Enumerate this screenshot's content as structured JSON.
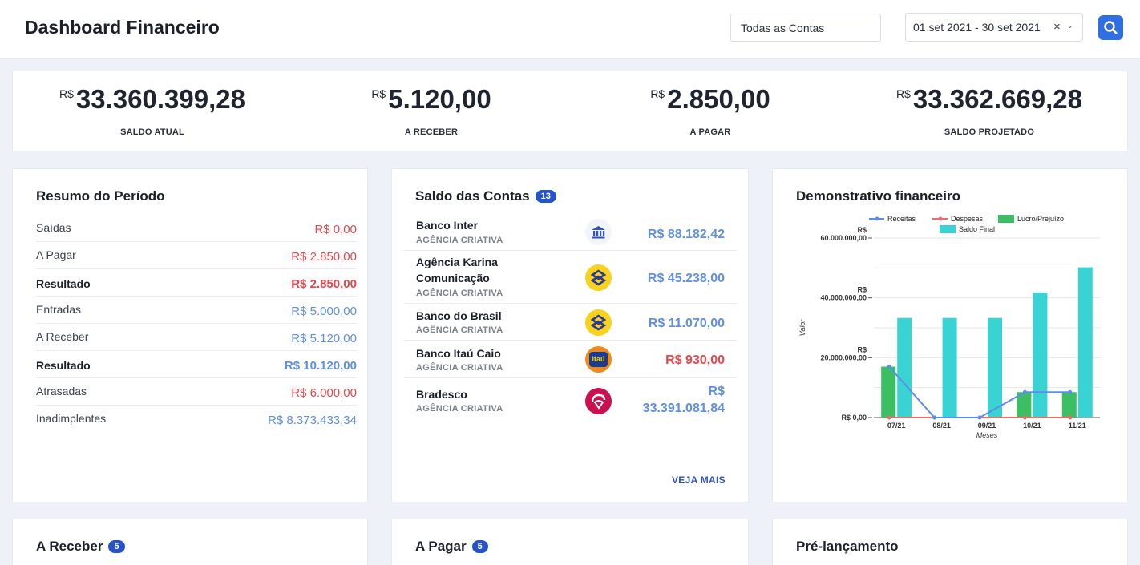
{
  "header": {
    "title": "Dashboard Financeiro",
    "account_filter": "Todas as Contas",
    "date_range": "01 set 2021 - 30 set 2021",
    "clear_symbol": "×",
    "chevron_symbol": "⌄"
  },
  "kpis": [
    {
      "currency": "R$",
      "value": "33.360.399,28",
      "label": "SALDO ATUAL",
      "color": "#5f8fe8"
    },
    {
      "currency": "R$",
      "value": "5.120,00",
      "label": "A RECEBER",
      "color": "#5f8fe8"
    },
    {
      "currency": "R$",
      "value": "2.850,00",
      "label": "A PAGAR",
      "color": "#e8464b"
    },
    {
      "currency": "R$",
      "value": "33.362.669,28",
      "label": "SALDO PROJETADO",
      "color": "#5f8fe8"
    }
  ],
  "resumo": {
    "title": "Resumo do Período",
    "rows": [
      {
        "label": "Saídas",
        "value": "R$ 0,00",
        "tone": "red"
      },
      {
        "label": "A Pagar",
        "value": "R$ 2.850,00",
        "tone": "red"
      },
      {
        "label": "Resultado",
        "value": "R$ 2.850,00",
        "tone": "red"
      },
      {
        "label": "Entradas",
        "value": "R$ 5.000,00",
        "tone": "blue"
      },
      {
        "label": "A Receber",
        "value": "R$ 5.120,00",
        "tone": "blue"
      },
      {
        "label": "Resultado",
        "value": "R$ 10.120,00",
        "tone": "blue"
      },
      {
        "label": "Atrasadas",
        "value": "R$ 6.000,00",
        "tone": "red"
      },
      {
        "label": "Inadimplentes",
        "value": "R$ 8.373.433,34",
        "tone": "blue"
      }
    ]
  },
  "contas": {
    "title": "Saldo das Contas",
    "count": "13",
    "accounts": [
      {
        "name": "Banco Inter",
        "agency": "AGÊNCIA CRIATIVA",
        "value": "R$ 88.182,42",
        "tone": "blue",
        "icon": "bank-building-icon"
      },
      {
        "name": "Agência Karina Comunicação",
        "name_line1": "Agência Karina",
        "name_line2": "Comunicação",
        "agency": "AGÊNCIA CRIATIVA",
        "value": "R$ 45.238,00",
        "tone": "blue",
        "icon": "banco-do-brasil-icon"
      },
      {
        "name": "Banco do Brasil",
        "agency": "AGÊNCIA CRIATIVA",
        "value": "R$ 11.070,00",
        "tone": "blue",
        "icon": "banco-do-brasil-icon"
      },
      {
        "name": "Banco Itaú Caio",
        "agency": "AGÊNCIA CRIATIVA",
        "value": "R$ 930,00",
        "tone": "red",
        "icon": "itau-icon",
        "icon_text": "itaú"
      },
      {
        "name": "Bradesco",
        "agency": "AGÊNCIA CRIATIVA",
        "value": "R$ 33.391.081,84",
        "value_line1": "R$",
        "value_line2": "33.391.081,84",
        "tone": "blue",
        "icon": "bradesco-icon"
      }
    ],
    "more_label": "VEJA MAIS"
  },
  "chart_data": {
    "type": "bar",
    "title": "Demonstrativo financeiro",
    "xlabel": "Meses",
    "ylabel": "Valor",
    "categories": [
      "07/21",
      "08/21",
      "09/21",
      "10/21",
      "11/21"
    ],
    "y_ticks": [
      {
        "line1": "R$",
        "line2": "60.000.000,00"
      },
      {
        "line1": "R$",
        "line2": "40.000.000,00"
      },
      {
        "line1": "R$",
        "line2": "20.000.000,00"
      },
      {
        "line1": "",
        "line2": "R$ 0,00"
      }
    ],
    "ylim": [
      0,
      60000000
    ],
    "series": [
      {
        "name": "Receitas",
        "kind": "line",
        "color": "#5b8def",
        "values": [
          17000000,
          0,
          0,
          8500000,
          8500000
        ]
      },
      {
        "name": "Despesas",
        "kind": "line",
        "color": "#ef6b6b",
        "values": [
          0,
          0,
          0,
          0,
          0
        ]
      },
      {
        "name": "Lucro/Prejuízo",
        "kind": "bar",
        "color": "#3cbf63",
        "values": [
          17000000,
          0,
          0,
          8500000,
          8500000
        ]
      },
      {
        "name": "Saldo Final",
        "kind": "bar",
        "color": "#3ad3d3",
        "values": [
          33300000,
          33300000,
          33300000,
          41800000,
          50200000
        ]
      }
    ],
    "legend_position": "top",
    "grid": true
  },
  "bottom": {
    "receber_title": "A Receber",
    "receber_count": "5",
    "pagar_title": "A Pagar",
    "pagar_count": "5",
    "pre_title": "Pré-lançamento"
  }
}
